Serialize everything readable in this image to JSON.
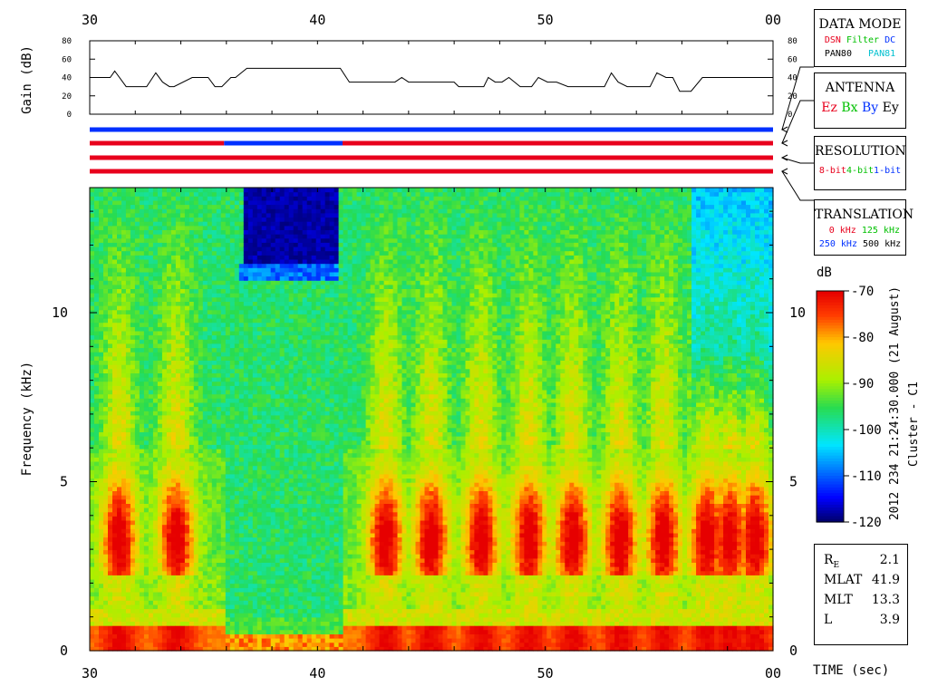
{
  "colors": {
    "ez": "#e8001c",
    "bx": "#00c000",
    "by": "#0030ff",
    "ey": "#000000",
    "dsn": "#e8001c",
    "filter": "#00c000",
    "dc": "#0030ff",
    "pan80": "#000000",
    "pan81": "#00c0d0",
    "res_8bit": "#e8001c",
    "res_4bit": "#00c000",
    "res_1bit": "#0030ff",
    "tr_0": "#e8001c",
    "tr_125": "#00c000",
    "tr_250": "#0030ff",
    "tr_500": "#000000"
  },
  "panels": {
    "data_mode": {
      "title": "DATA MODE",
      "dsn": "DSN",
      "filter": "Filter",
      "dc": "DC",
      "pan80": "PAN80",
      "pan81": "PAN81"
    },
    "antenna": {
      "title": "ANTENNA",
      "ez": "Ez",
      "bx": "Bx",
      "by": "By",
      "ey": "Ey"
    },
    "resolution": {
      "title": "RESOLUTION",
      "r8": "8-bit",
      "r4": "4-bit",
      "r1": "1-bit"
    },
    "translation": {
      "title": "TRANSLATION",
      "t0": "0 kHz",
      "t125": "125 kHz",
      "t250": "250 kHz",
      "t500": "500 kHz"
    }
  },
  "orbit_info": [
    {
      "label": "R",
      "sub": "E",
      "value": "2.1"
    },
    {
      "label": "MLAT",
      "sub": "",
      "value": "41.9"
    },
    {
      "label": "MLT",
      "sub": "",
      "value": "13.3"
    },
    {
      "label": "L",
      "sub": "",
      "value": "3.9"
    }
  ],
  "side_label": {
    "timestamp": "2012 234 21:24:30.000 (21 August)",
    "spacecraft": "Cluster - C1"
  },
  "colorbar": {
    "unit": "dB",
    "ticks": [
      "-70",
      "-80",
      "-90",
      "-100",
      "-110",
      "-120"
    ],
    "min": -120,
    "max": -70
  },
  "chart_data": [
    {
      "type": "line",
      "name": "gain",
      "ylabel": "Gain (dB)",
      "yticks": [
        "0",
        "20",
        "40",
        "60",
        "80"
      ],
      "ylim": [
        0,
        80
      ],
      "xlim": [
        30,
        60
      ],
      "xticks": [
        "30",
        "40",
        "50",
        "00"
      ],
      "x": [
        30,
        30.9,
        31.1,
        31.6,
        32.5,
        32.9,
        33.2,
        33.5,
        33.7,
        34.5,
        34.9,
        35.2,
        35.5,
        35.8,
        36.2,
        36.4,
        36.9,
        41.0,
        41.4,
        43.0,
        43.4,
        43.7,
        44.0,
        44.6,
        46.0,
        46.2,
        47.3,
        47.5,
        47.8,
        48.1,
        48.4,
        48.9,
        49.4,
        49.7,
        50.1,
        50.5,
        51.0,
        51.4,
        52.6,
        52.9,
        53.2,
        53.6,
        54.6,
        54.9,
        55.3,
        55.6,
        55.9,
        56.4,
        56.9,
        57.5,
        60
      ],
      "y": [
        40,
        40,
        47,
        30,
        30,
        45,
        35,
        30,
        30,
        40,
        40,
        40,
        30,
        30,
        40,
        40,
        50,
        50,
        35,
        35,
        35,
        40,
        35,
        35,
        35,
        30,
        30,
        40,
        35,
        35,
        40,
        30,
        30,
        40,
        35,
        35,
        30,
        30,
        30,
        45,
        35,
        30,
        30,
        45,
        40,
        40,
        25,
        25,
        40,
        40,
        40
      ]
    },
    {
      "type": "heatmap",
      "name": "spectrogram",
      "ylabel": "Frequency (kHz)",
      "xlabel": "TIME (sec)",
      "xlim": [
        30,
        60
      ],
      "ylim": [
        0,
        13.7
      ],
      "xticks": [
        "30",
        "40",
        "50",
        "00"
      ],
      "yticks": [
        "0",
        "5",
        "10"
      ],
      "zlim": [
        -120,
        -70
      ],
      "zunit": "dB",
      "segments": [
        {
          "x0": 30.0,
          "x1": 35.9,
          "mode": "bursts"
        },
        {
          "x0": 35.9,
          "x1": 41.1,
          "mode": "calm"
        },
        {
          "x0": 41.1,
          "x1": 60.0,
          "mode": "bursts"
        }
      ],
      "burst_centers": [
        31.3,
        33.8,
        43.0,
        45.0,
        47.2,
        49.3,
        51.2,
        53.3,
        55.2,
        57.1,
        58.1,
        59.2
      ],
      "void_block": {
        "x0": 36.7,
        "x1": 41.0,
        "y0": 11.5,
        "y1": 13.7
      }
    },
    {
      "type": "bar",
      "name": "mode-strips",
      "strips": [
        {
          "segments": [
            {
              "x0": 30,
              "x1": 60,
              "color": "#0030ff"
            }
          ]
        },
        {
          "segments": [
            {
              "x0": 30,
              "x1": 35.9,
              "color": "#e8001c"
            },
            {
              "x0": 35.9,
              "x1": 41.1,
              "color": "#0030ff"
            },
            {
              "x0": 41.1,
              "x1": 60,
              "color": "#e8001c"
            }
          ]
        },
        {
          "segments": [
            {
              "x0": 30,
              "x1": 60,
              "color": "#e8001c"
            }
          ]
        },
        {
          "segments": [
            {
              "x0": 30,
              "x1": 60,
              "color": "#e8001c"
            }
          ]
        }
      ]
    }
  ]
}
